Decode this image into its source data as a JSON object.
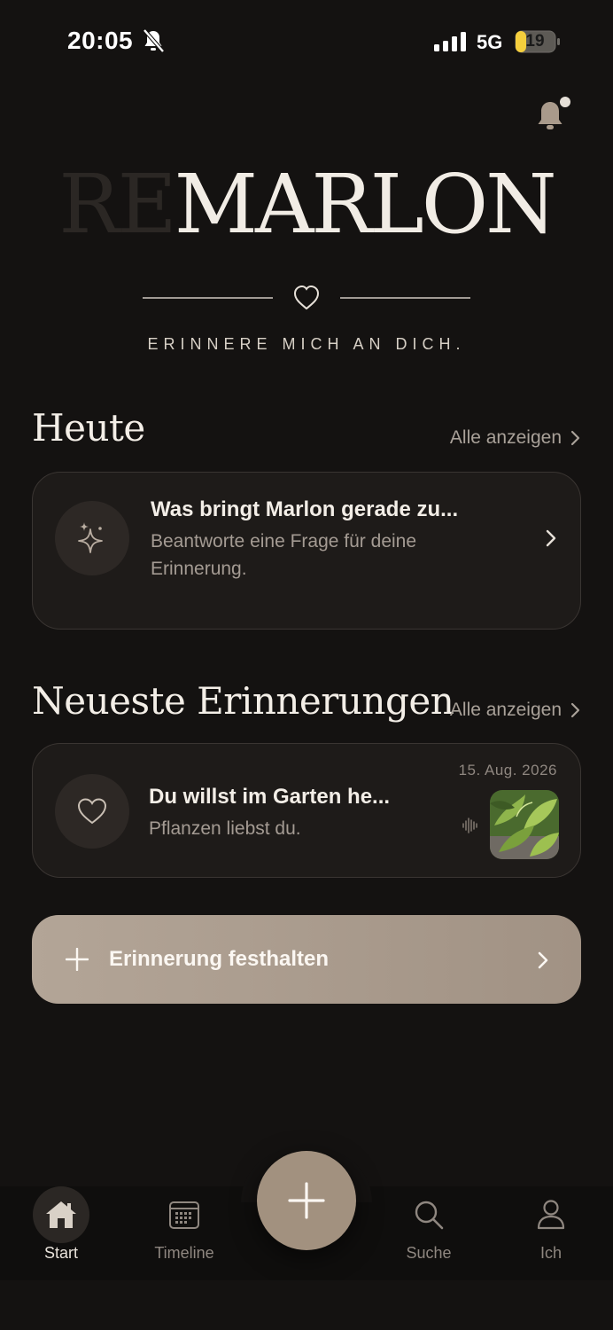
{
  "status_bar": {
    "time": "20:05",
    "network": "5G",
    "battery": "19",
    "icons": [
      "bell-slash-icon",
      "signal-icon",
      "battery-icon"
    ]
  },
  "header": {
    "logo_prefix": "RE",
    "logo_name": "MARLON",
    "tagline": "ERINNERE MICH AN DICH.",
    "icons": [
      "bell-icon",
      "heart-icon"
    ]
  },
  "today": {
    "title": "Heute",
    "show_all": "Alle anzeigen",
    "card": {
      "title": "Was bringt Marlon gerade zu...",
      "subtitle": "Beantworte eine Frage für deine Erinnerung.",
      "icon": "sparkles-icon"
    }
  },
  "latest": {
    "title": "Neueste Erinnerungen",
    "show_all": "Alle anzeigen",
    "item": {
      "date": "15. Aug. 2026",
      "title": "Du willst im Garten he...",
      "subtitle": "Pflanzen liebst du.",
      "icon": "heart-icon",
      "audio_icon": "waveform-icon",
      "thumbnail": "plant-photo"
    }
  },
  "cta": {
    "label": "Erinnerung festhalten",
    "icon": "plus-icon"
  },
  "tabbar": {
    "tabs": [
      {
        "label": "Start",
        "icon": "house-icon",
        "active": true
      },
      {
        "label": "Timeline",
        "icon": "calendar-icon",
        "active": false
      },
      {
        "label": "Suche",
        "icon": "search-icon",
        "active": false
      },
      {
        "label": "Ich",
        "icon": "person-icon",
        "active": false
      }
    ],
    "fab_icon": "plus-icon"
  },
  "colors": {
    "background": "#141211",
    "accent": "#a2917f",
    "card": "#1e1b19",
    "muted_text": "#a49b93"
  }
}
